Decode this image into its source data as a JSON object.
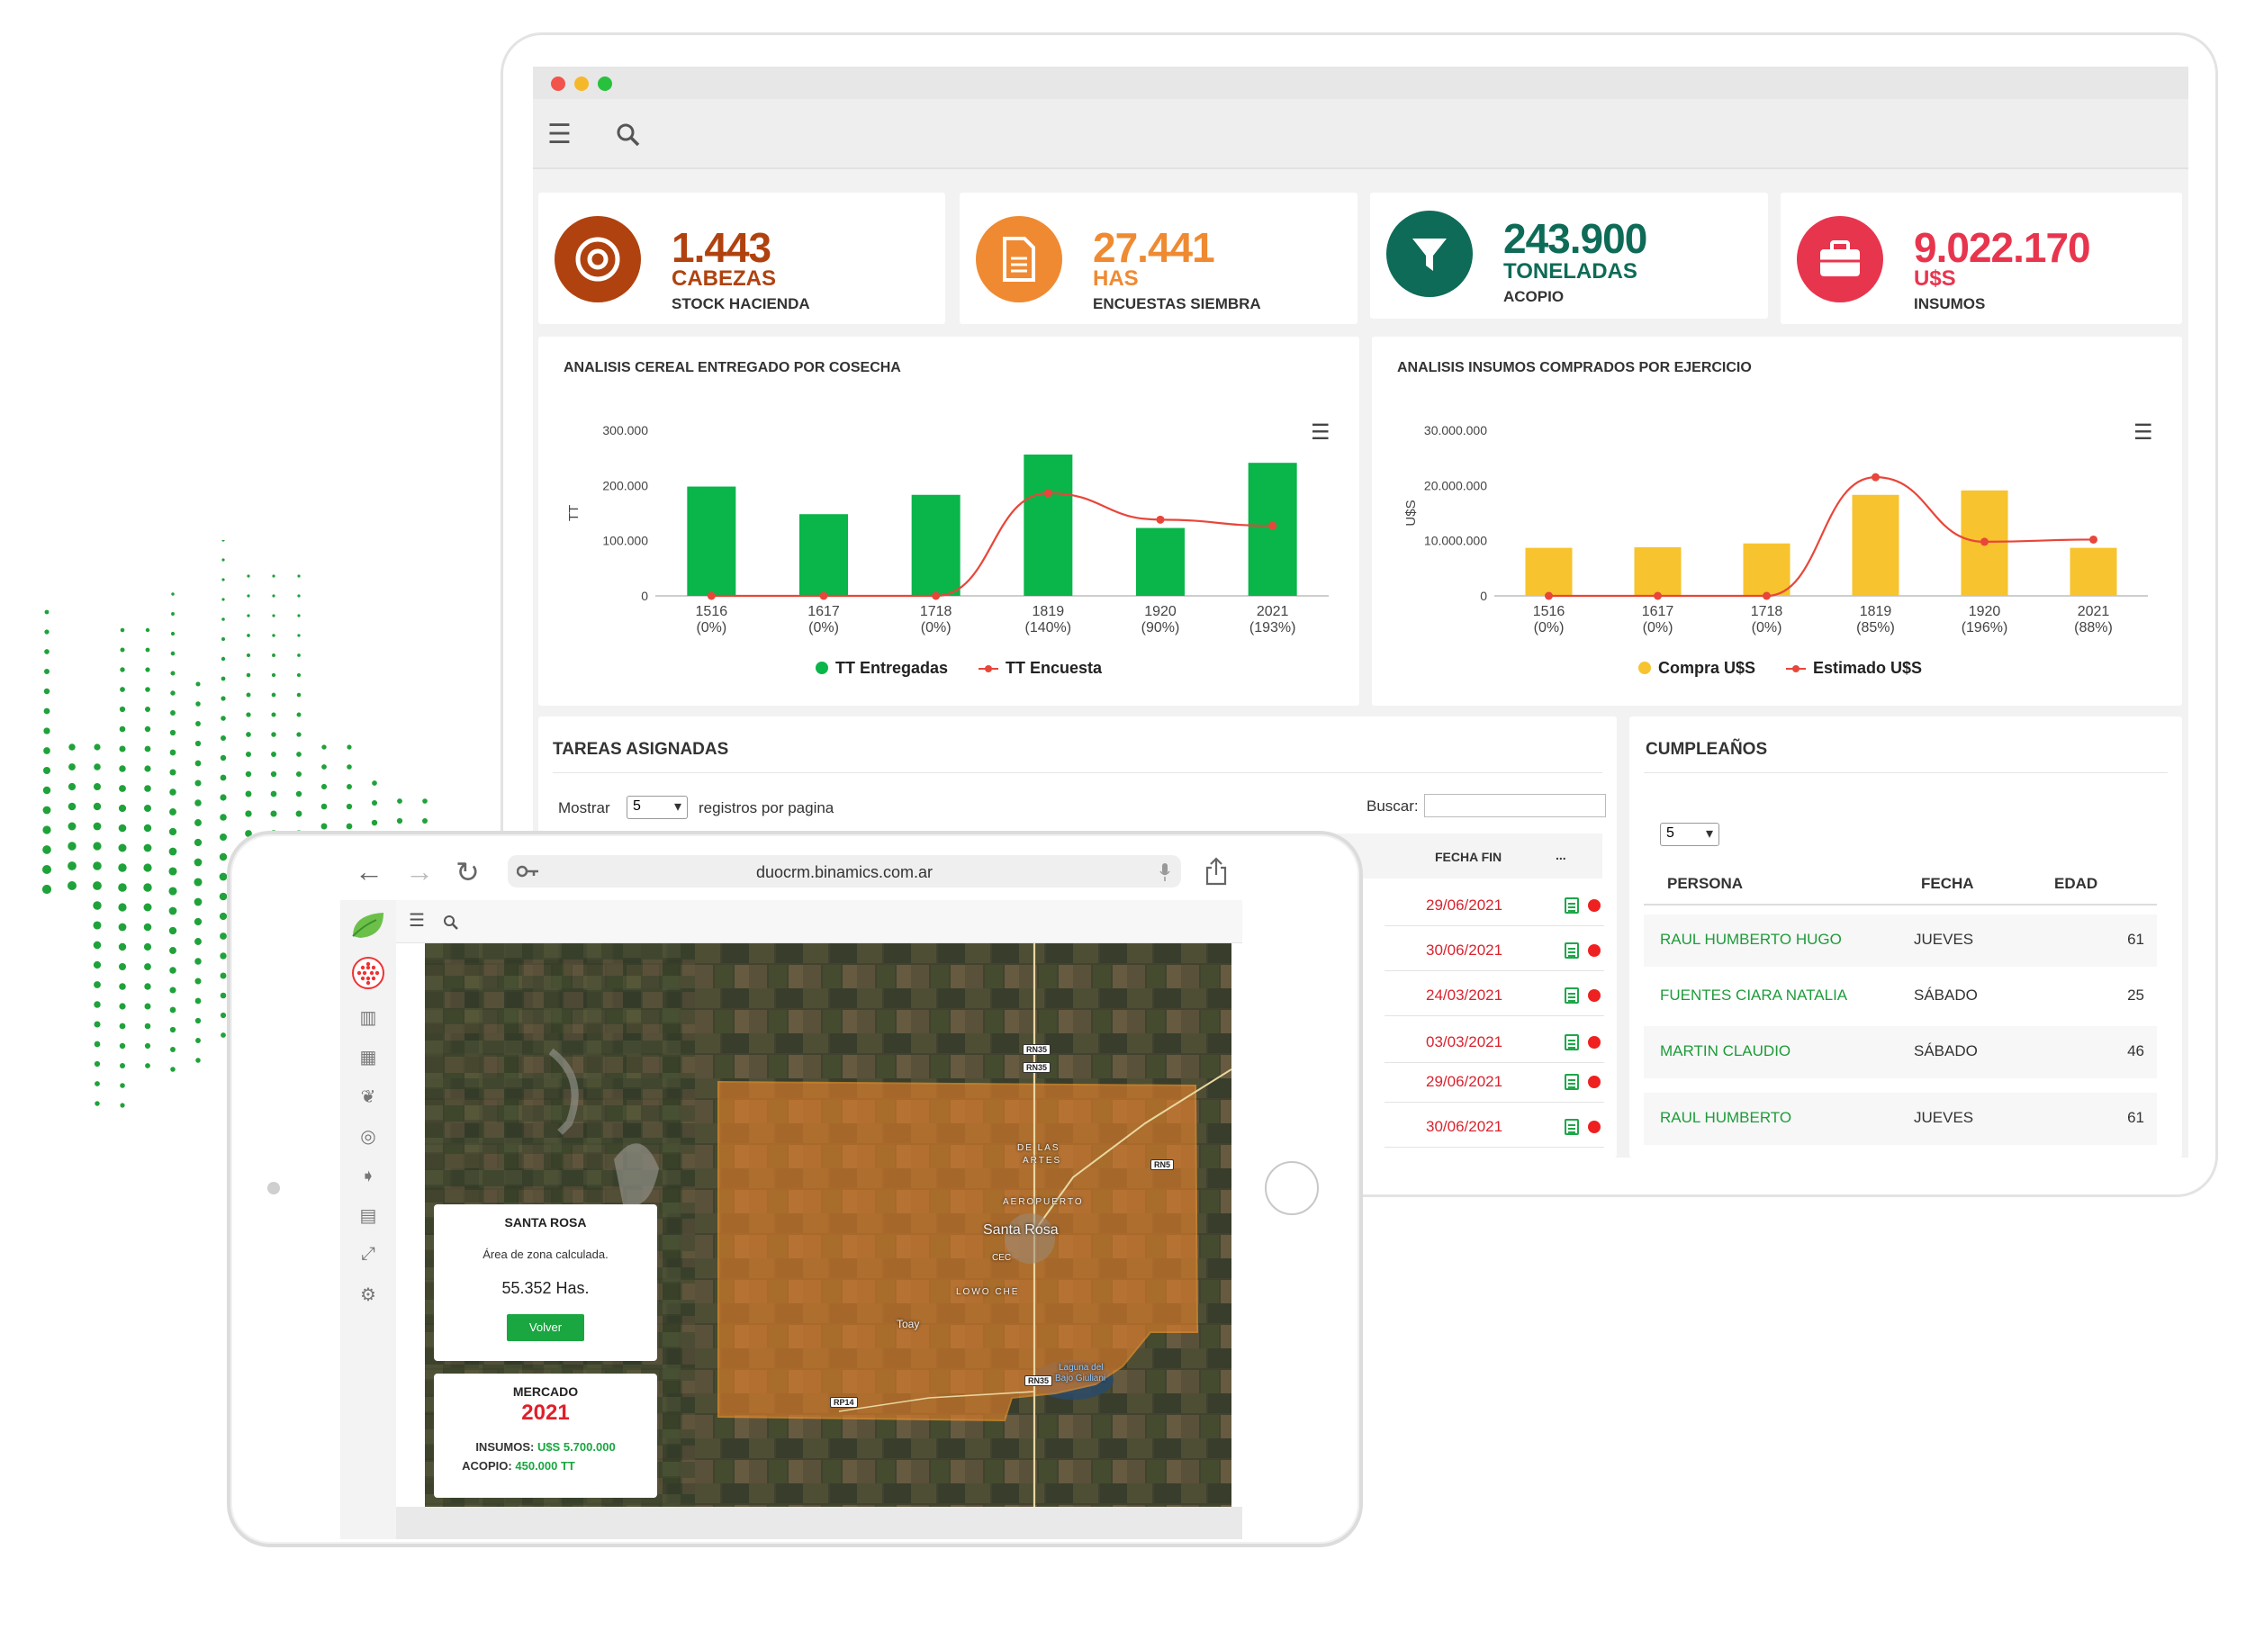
{
  "colors": {
    "green": "#0ab54a",
    "yellow": "#f7c32e",
    "red_line": "#e8463a",
    "cabezas": "#b0420f",
    "has": "#ef8a32",
    "toneladas": "#0e6b57",
    "insumos": "#e8354e",
    "link_green": "#1e9b3a",
    "date_red": "#d9232e"
  },
  "desktop": {
    "toolbar": {
      "menu_icon": "hamburger-menu-icon",
      "search_icon": "search-icon"
    },
    "kpis": [
      {
        "icon": "target-icon",
        "value": "1.443",
        "unit": "CABEZAS",
        "label": "STOCK HACIENDA"
      },
      {
        "icon": "document-icon",
        "value": "27.441",
        "unit": "HAS",
        "label": "ENCUESTAS SIEMBRA"
      },
      {
        "icon": "filter-icon",
        "value": "243.900",
        "unit": "TONELADAS",
        "label": "ACOPIO"
      },
      {
        "icon": "briefcase-icon",
        "value": "9.022.170",
        "unit": "U$S",
        "label": "INSUMOS"
      }
    ],
    "tareas": {
      "title": "TAREAS ASIGNADAS",
      "show_label": "Mostrar",
      "show_value": "5",
      "per_page_label": "registros por pagina",
      "search_label": "Buscar:",
      "search_value": "",
      "col_fecha_fin": "FECHA FIN",
      "col_actions": "...",
      "rows": [
        {
          "fecha_fin": "29/06/2021"
        },
        {
          "fecha_fin": "30/06/2021"
        },
        {
          "fecha_fin": "24/03/2021"
        },
        {
          "fecha_fin": "03/03/2021"
        },
        {
          "fecha_fin": "29/06/2021"
        },
        {
          "fecha_fin": "30/06/2021"
        }
      ]
    },
    "cumple": {
      "title": "CUMPLEAÑOS",
      "show_value": "5",
      "col_persona": "PERSONA",
      "col_fecha": "FECHA",
      "col_edad": "EDAD",
      "rows": [
        {
          "persona": "RAUL HUMBERTO HUGO",
          "fecha": "JUEVES",
          "edad": "61"
        },
        {
          "persona": "FUENTES CIARA NATALIA",
          "fecha": "SÁBADO",
          "edad": "25"
        },
        {
          "persona": "MARTIN CLAUDIO",
          "fecha": "SÁBADO",
          "edad": "46"
        },
        {
          "persona": "RAUL HUMBERTO",
          "fecha": "JUEVES",
          "edad": "61"
        }
      ]
    }
  },
  "chart_data": [
    {
      "type": "bar",
      "title": "ANALISIS CEREAL ENTREGADO POR COSECHA",
      "ylabel": "TT",
      "ylim": [
        0,
        300000
      ],
      "yticks": [
        "300.000",
        "200.000",
        "100.000",
        "0"
      ],
      "ytick_values": [
        300000,
        200000,
        100000,
        0
      ],
      "categories": [
        "1516",
        "1617",
        "1718",
        "1819",
        "1920",
        "2021"
      ],
      "sublabels": [
        "(0%)",
        "(0%)",
        "(0%)",
        "(140%)",
        "(90%)",
        "(193%)"
      ],
      "series": [
        {
          "name": "TT Entregadas",
          "kind": "bar",
          "values": [
            198000,
            148000,
            183000,
            256000,
            123000,
            241000
          ]
        },
        {
          "name": "TT Encuesta",
          "kind": "line",
          "values": [
            0,
            0,
            0,
            186000,
            138000,
            127000
          ]
        }
      ],
      "legend": "bottom-center"
    },
    {
      "type": "bar",
      "title": "ANALISIS INSUMOS COMPRADOS POR EJERCICIO",
      "ylabel": "U$S",
      "ylim": [
        0,
        30000000
      ],
      "yticks": [
        "30.000.000",
        "20.000.000",
        "10.000.000",
        "0"
      ],
      "ytick_values": [
        30000000,
        20000000,
        10000000,
        0
      ],
      "categories": [
        "1516",
        "1617",
        "1718",
        "1819",
        "1920",
        "2021"
      ],
      "sublabels": [
        "(0%)",
        "(0%)",
        "(0%)",
        "(85%)",
        "(196%)",
        "(88%)"
      ],
      "series": [
        {
          "name": "Compra U$S",
          "kind": "bar",
          "values": [
            8700000,
            8800000,
            9500000,
            18300000,
            19100000,
            8700000
          ]
        },
        {
          "name": "Estimado U$S",
          "kind": "line",
          "values": [
            0,
            0,
            0,
            21500000,
            9800000,
            10200000
          ]
        }
      ],
      "legend": "bottom-center"
    }
  ],
  "tablet": {
    "url": "duocrm.binamics.com.ar",
    "santa_rosa": {
      "title": "SANTA ROSA",
      "subtitle": "Área de zona calculada.",
      "area": "55.352 Has.",
      "button": "Volver"
    },
    "mercado": {
      "title": "MERCADO",
      "year": "2021",
      "insumos_label": "INSUMOS:",
      "insumos_value": "U$S 5.700.000",
      "acopio_label": "ACOPIO:",
      "acopio_value": "450.000 TT"
    },
    "map_labels": {
      "city": "Santa Rosa",
      "aeropuerto": "AEROPUERTO",
      "de_las": "DE LAS",
      "artes": "ARTES",
      "lowo": "LOWO CHE",
      "cec": "CEC",
      "toay": "Toay",
      "laguna": "Laguna del",
      "laguna2": "Bajo Giuliani",
      "rn35a": "RN35",
      "rn35b": "RN35",
      "rn5": "RN5",
      "rn35c": "RN35",
      "rp14": "RP14"
    }
  }
}
